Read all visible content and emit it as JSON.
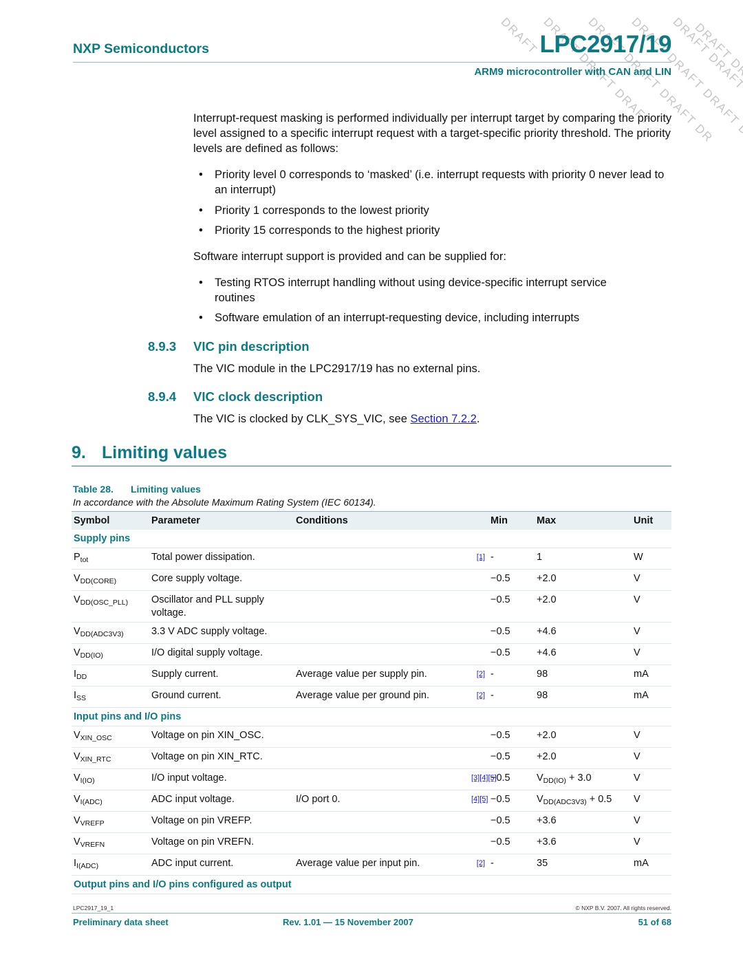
{
  "header": {
    "company": "NXP Semiconductors",
    "title": "LPC2917/19",
    "subtitle": "ARM9 microcontroller with CAN and LIN"
  },
  "watermark": {
    "text": "DRAFT",
    "fragments": [
      "DRAFT",
      "DRAFT DRAFT DRAFT",
      "DRAFT DRAFT DRAFT DR",
      "DRAFT DRAFT DRAFT DRAF",
      "DRAFT DRAFT DRAFT D",
      "DRAFT DRAFT DRA"
    ]
  },
  "intro": {
    "paragraph": "Interrupt-request masking is performed individually per interrupt target by comparing the priority level assigned to a specific interrupt request with a target-specific priority threshold. The priority levels are defined as follows:",
    "bullets": [
      "Priority level 0 corresponds to ‘masked’ (i.e. interrupt requests with priority 0 never lead to an interrupt)",
      "Priority 1 corresponds to the lowest priority",
      "Priority 15 corresponds to the highest priority"
    ],
    "paragraph2": "Software interrupt support is provided and can be supplied for:",
    "bullets2": [
      "Testing RTOS interrupt handling without using device-specific interrupt service routines",
      "Software emulation of an interrupt-requesting device, including interrupts"
    ],
    "bullet_glyph": "•"
  },
  "sections": {
    "s893": {
      "number": "8.9.3",
      "title": "VIC pin description",
      "text": "The VIC module in the LPC2917/19 has no external pins."
    },
    "s894": {
      "number": "8.9.4",
      "title": "VIC clock description",
      "text_before": "The VIC is clocked by CLK_SYS_VIC, see ",
      "link": "Section 7.2.2",
      "text_after": "."
    },
    "s9": {
      "number": "9.",
      "title": "Limiting values"
    }
  },
  "table": {
    "caption_number": "Table 28.",
    "caption_title": "Limiting values",
    "note": "In accordance with the Absolute Maximum Rating System (IEC 60134).",
    "headers": {
      "symbol": "Symbol",
      "parameter": "Parameter",
      "conditions": "Conditions",
      "min": "Min",
      "max": "Max",
      "unit": "Unit"
    },
    "groups": [
      {
        "label": "Supply pins",
        "rows": [
          {
            "sym": "P",
            "sub": "tot",
            "param": "Total power dissipation.",
            "cond": "",
            "refs": "[1]",
            "min": "-",
            "max": "1",
            "max_sub": "",
            "max_suffix": "",
            "unit": "W"
          },
          {
            "sym": "V",
            "sub": "DD(CORE)",
            "param": "Core supply voltage.",
            "cond": "",
            "refs": "",
            "min": "−0.5",
            "max": "+2.0",
            "max_sub": "",
            "max_suffix": "",
            "unit": "V"
          },
          {
            "sym": "V",
            "sub": "DD(OSC_PLL)",
            "param": "Oscillator and PLL supply voltage.",
            "cond": "",
            "refs": "",
            "min": "−0.5",
            "max": "+2.0",
            "max_sub": "",
            "max_suffix": "",
            "unit": "V"
          },
          {
            "sym": "V",
            "sub": "DD(ADC3V3)",
            "param": "3.3 V ADC supply voltage.",
            "cond": "",
            "refs": "",
            "min": "−0.5",
            "max": "+4.6",
            "max_sub": "",
            "max_suffix": "",
            "unit": "V"
          },
          {
            "sym": "V",
            "sub": "DD(IO)",
            "param": "I/O digital supply voltage.",
            "cond": "",
            "refs": "",
            "min": "−0.5",
            "max": "+4.6",
            "max_sub": "",
            "max_suffix": "",
            "unit": "V"
          },
          {
            "sym": "I",
            "sub": "DD",
            "param": "Supply current.",
            "cond": "Average value per supply pin.",
            "refs": "[2]",
            "min": "-",
            "max": "98",
            "max_sub": "",
            "max_suffix": "",
            "unit": "mA"
          },
          {
            "sym": "I",
            "sub": "SS",
            "param": "Ground current.",
            "cond": "Average value per ground pin.",
            "refs": "[2]",
            "min": "-",
            "max": "98",
            "max_sub": "",
            "max_suffix": "",
            "unit": "mA"
          }
        ]
      },
      {
        "label": "Input pins and I/O pins",
        "rows": [
          {
            "sym": "V",
            "sub": "XIN_OSC",
            "param": "Voltage on pin XIN_OSC.",
            "cond": "",
            "refs": "",
            "min": "−0.5",
            "max": "+2.0",
            "max_sub": "",
            "max_suffix": "",
            "unit": "V"
          },
          {
            "sym": "V",
            "sub": "XIN_RTC",
            "param": "Voltage on pin XIN_RTC.",
            "cond": "",
            "refs": "",
            "min": "−0.5",
            "max": "+2.0",
            "max_sub": "",
            "max_suffix": "",
            "unit": "V"
          },
          {
            "sym": "V",
            "sub": "I(IO)",
            "param": "I/O input voltage.",
            "cond": "",
            "refs": "[3][4][5]",
            "min": "−0.5",
            "max": "V",
            "max_sub": "DD(IO)",
            "max_suffix": " + 3.0",
            "unit": "V"
          },
          {
            "sym": "V",
            "sub": "I(ADC)",
            "param": "ADC input voltage.",
            "cond": "I/O port 0.",
            "refs": "[4][5]",
            "min": "−0.5",
            "max": "V",
            "max_sub": "DD(ADC3V3)",
            "max_suffix": " + 0.5",
            "unit": "V"
          },
          {
            "sym": "V",
            "sub": "VREFP",
            "param": "Voltage on pin VREFP.",
            "cond": "",
            "refs": "",
            "min": "−0.5",
            "max": "+3.6",
            "max_sub": "",
            "max_suffix": "",
            "unit": "V"
          },
          {
            "sym": "V",
            "sub": "VREFN",
            "param": "Voltage on pin VREFN.",
            "cond": "",
            "refs": "",
            "min": "−0.5",
            "max": "+3.6",
            "max_sub": "",
            "max_suffix": "",
            "unit": "V"
          },
          {
            "sym": "I",
            "sub": "I(ADC)",
            "param": "ADC input current.",
            "cond": "Average value per input pin.",
            "refs": "[2]",
            "min": "-",
            "max": "35",
            "max_sub": "",
            "max_suffix": "",
            "unit": "mA"
          }
        ]
      },
      {
        "label": "Output pins and I/O pins configured as output",
        "rows": []
      }
    ]
  },
  "footer": {
    "doc_id": "LPC2917_19_1",
    "copyright": "© NXP B.V. 2007. All rights reserved.",
    "left": "Preliminary data sheet",
    "middle": "Rev. 1.01 — 15 November 2007",
    "right": "51 of 68"
  }
}
